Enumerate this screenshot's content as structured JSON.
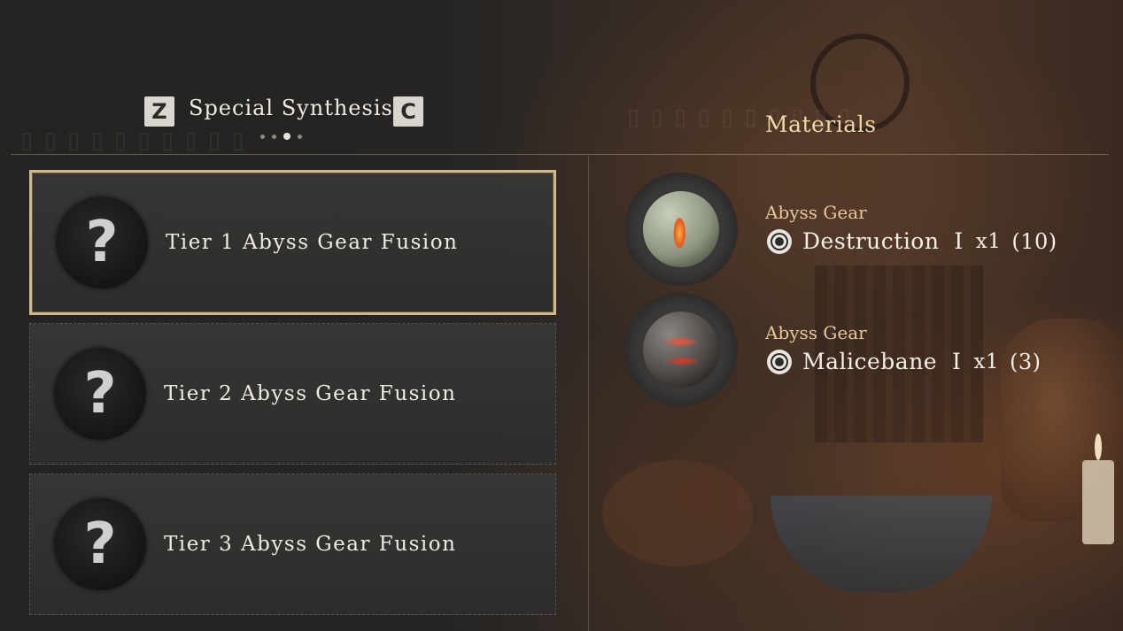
{
  "header": {
    "prev_key": "Z",
    "title": "Special Synthesis",
    "next_key": "C",
    "page_dots": {
      "count": 4,
      "active_index": 2
    }
  },
  "recipes": [
    {
      "label": "Tier 1 Abyss Gear Fusion",
      "icon": "question-mark-icon",
      "selected": true
    },
    {
      "label": "Tier 2 Abyss Gear Fusion",
      "icon": "question-mark-icon",
      "selected": false
    },
    {
      "label": "Tier 3 Abyss Gear Fusion",
      "icon": "question-mark-icon",
      "selected": false
    }
  ],
  "materials": {
    "title": "Materials",
    "items": [
      {
        "category": "Abyss Gear",
        "name": "Destruction  I",
        "quantity": "x1",
        "owned": "(10)",
        "icon": "destruction-orb-icon"
      },
      {
        "category": "Abyss Gear",
        "name": "Malicebane  I",
        "quantity": "x1",
        "owned": "(3)",
        "icon": "malicebane-orb-icon"
      }
    ]
  },
  "colors": {
    "selected_border": "#cdb98d",
    "category_text": "#e6c79a",
    "materials_title": "#f2d7a8"
  }
}
